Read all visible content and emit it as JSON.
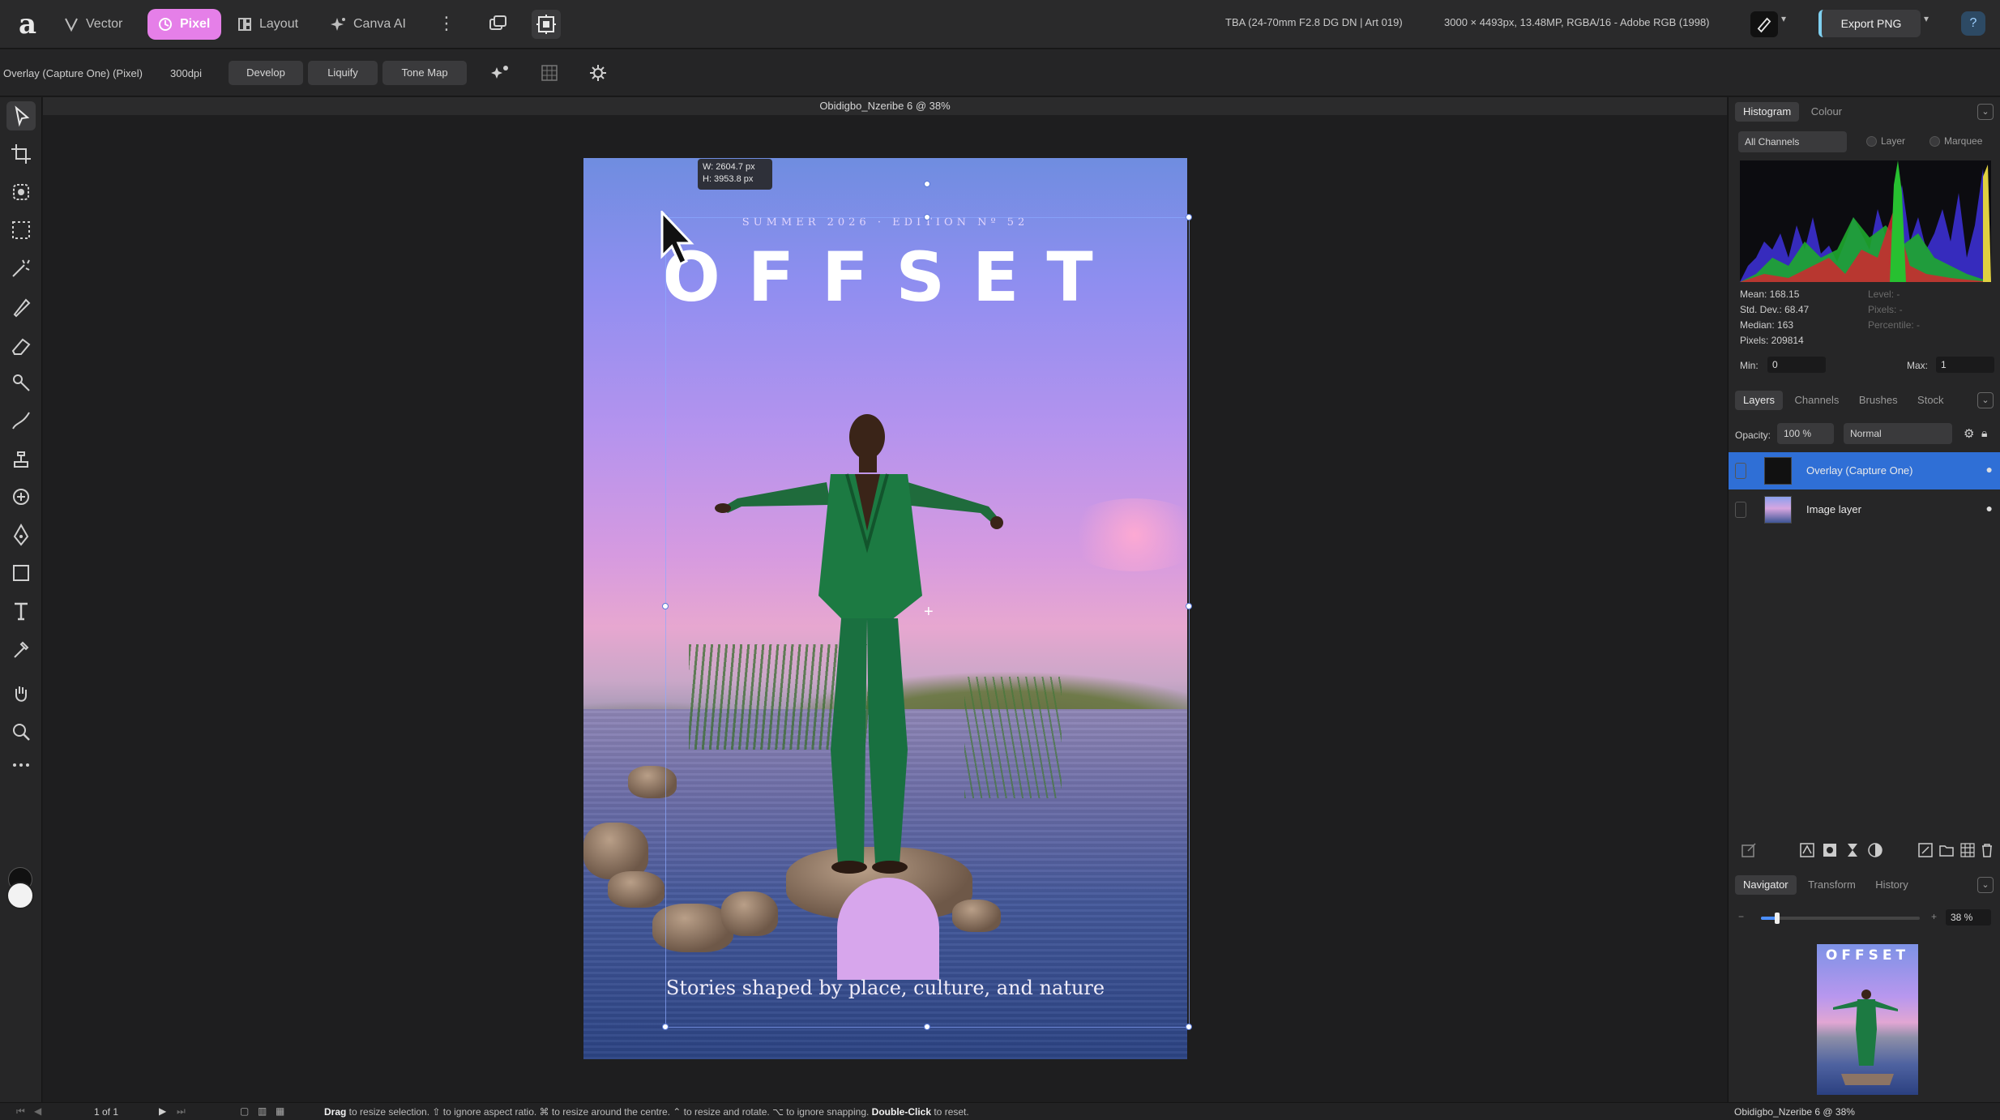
{
  "topbar": {
    "personas": [
      {
        "label": "Vector",
        "icon": "vector-pen-icon",
        "active": false
      },
      {
        "label": "Pixel",
        "icon": "pixel-brush-icon",
        "active": true
      },
      {
        "label": "Layout",
        "icon": "layout-grid-icon",
        "active": false
      },
      {
        "label": "Canva AI",
        "icon": "sparkle-icon",
        "active": false
      }
    ],
    "camera_info": "TBA (24-70mm F2.8 DG DN | Art 019)",
    "document_info": "3000 × 4493px, 13.48MP, RGBA/16 - Adobe RGB (1998)",
    "export_label": "Export PNG",
    "help_label": "?"
  },
  "context_toolbar": {
    "layer_label": "Overlay (Capture One) (Pixel)",
    "dpi": "300dpi",
    "buttons": [
      "Develop",
      "Liquify",
      "Tone Map"
    ]
  },
  "canvas": {
    "document_tab": "Obidigbo_Nzeribe 6 @ 38%",
    "dimensions_tooltip": {
      "width": "W: 2604.7 px",
      "height": "H: 3953.8 px"
    },
    "artwork": {
      "kicker": "SUMMER 2026 · EDITION Nº 52",
      "title": "OFFSET",
      "tagline": "Stories shaped by place, culture, and nature"
    }
  },
  "histogram_panel": {
    "tabs": [
      "Histogram",
      "Colour"
    ],
    "channel_select": "All Channels",
    "radios": [
      "Layer",
      "Marquee"
    ],
    "stats": {
      "mean": "Mean: 168.15",
      "std_dev": "Std. Dev.: 68.47",
      "median": "Median: 163",
      "pixels": "Pixels: 209814",
      "level": "Level: -",
      "pixels_right": "Pixels: -",
      "percentile": "Percentile: -"
    },
    "min_label": "Min:",
    "min_value": "0",
    "max_label": "Max:",
    "max_value": "1"
  },
  "layers_panel": {
    "tabs": [
      "Layers",
      "Channels",
      "Brushes",
      "Stock"
    ],
    "opacity_label": "Opacity:",
    "opacity_value": "100 %",
    "blend_mode": "Normal",
    "layers": [
      {
        "name": "Overlay (Capture One)",
        "selected": true
      },
      {
        "name": "Image layer",
        "selected": false
      }
    ]
  },
  "navigator_panel": {
    "tabs": [
      "Navigator",
      "Transform",
      "History"
    ],
    "zoom_value": "38 %",
    "zoom_fraction": 0.1,
    "thumbnail_title": "OFFSET"
  },
  "statusbar": {
    "page": "1 of 1",
    "hint_parts": [
      {
        "bold": true,
        "text": "Drag"
      },
      {
        "bold": false,
        "text": " to resize selection. "
      },
      {
        "bold": false,
        "text": "⇧ to ignore aspect ratio. "
      },
      {
        "bold": false,
        "text": "⌘ to resize around the centre. "
      },
      {
        "bold": false,
        "text": "⌃ to resize and rotate. "
      },
      {
        "bold": false,
        "text": "⌥ to ignore snapping. "
      },
      {
        "bold": true,
        "text": "Double-Click"
      },
      {
        "bold": false,
        "text": " to reset."
      }
    ],
    "doc_name": "Obidigbo_Nzeribe 6 @ 38%"
  },
  "colors": {
    "accent_pixel": "#e57fe8",
    "selection_blue": "#2f6fd6",
    "panel_bg": "#262627"
  }
}
